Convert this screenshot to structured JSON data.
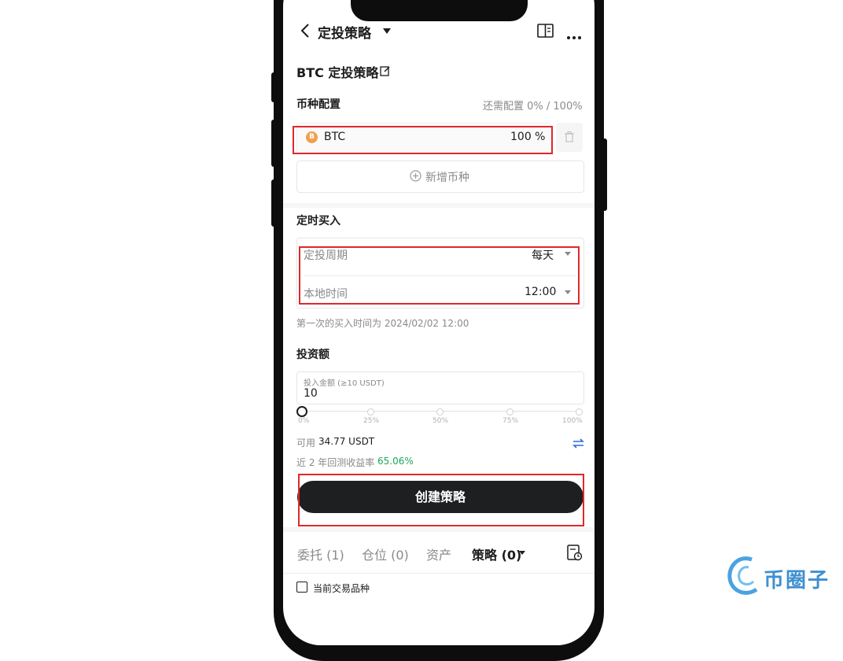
{
  "header": {
    "title": "定投策略"
  },
  "strategy": {
    "name": "BTC 定投策略"
  },
  "coin_config": {
    "label": "币种配置",
    "remaining": "还需配置 0% / 100%",
    "coin": {
      "symbol": "BTC",
      "percent": "100 %",
      "icon_letter": "B"
    },
    "add_label": "新增币种"
  },
  "schedule": {
    "label": "定时买入",
    "period_label": "定投周期",
    "period_value": "每天",
    "time_label": "本地时间",
    "time_value": "12:00",
    "first_buy_note": "第一次的买入时间为 2024/02/02 12:00"
  },
  "investment": {
    "label": "投资额",
    "amount_label": "投入金额 (≥10 USDT)",
    "amount_value": "10",
    "slider_level_percent": 0,
    "ticks": [
      "0%",
      "25%",
      "50%",
      "75%",
      "100%"
    ],
    "available_label": "可用",
    "available_value": "34.77 USDT",
    "return_label": "近 2 年回测收益率",
    "return_value": "65.06%"
  },
  "create_button": "创建策略",
  "tabs": [
    "委托 (1)",
    "仓位 (0)",
    "资产",
    "策略 (0)"
  ],
  "current_pair_label": "当前交易品种",
  "watermark": "币圈子",
  "colors": {
    "accent_red": "#e0282a",
    "positive_green": "#1aa760",
    "btn_dark": "#1d1f20",
    "btc_orange": "#f0a050",
    "link_blue": "#2a6fd6"
  }
}
